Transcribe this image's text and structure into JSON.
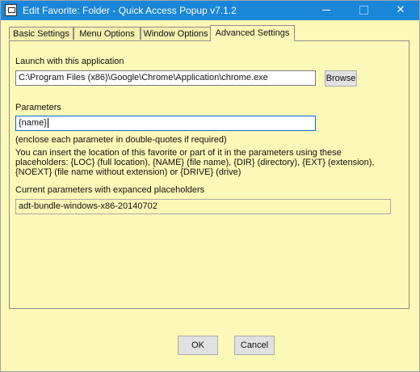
{
  "window": {
    "title": "Edit Favorite: Folder - Quick Access Popup v7.1.2"
  },
  "tabs": [
    {
      "label": "Basic Settings"
    },
    {
      "label": "Menu Options"
    },
    {
      "label": "Window Options"
    },
    {
      "label": "Advanced Settings"
    }
  ],
  "advanced": {
    "launch_label": "Launch with this application",
    "launch_value": "C:\\Program Files (x86)\\Google\\Chrome\\Application\\chrome.exe",
    "browse_label": "Browse",
    "params_label": "Parameters",
    "params_value": "{name}",
    "enclose_note": "(enclose each parameter in double-quotes if required)",
    "help_text": "You can insert the location of this favorite or part of it in the parameters using these placeholders: {LOC} (full location), {NAME} (file name), {DIR} (directory), {EXT} (extension), {NOEXT} (file name without extension) or {DRIVE} (drive)",
    "current_label": "Current parameters with expanced placeholders",
    "current_value": "adt-bundle-windows-x86-20140702"
  },
  "footer": {
    "ok_label": "OK",
    "cancel_label": "Cancel"
  },
  "colors": {
    "background": "#fcf8b7",
    "titlebar": "#1986d8",
    "focus_border": "#0b6ccf"
  }
}
